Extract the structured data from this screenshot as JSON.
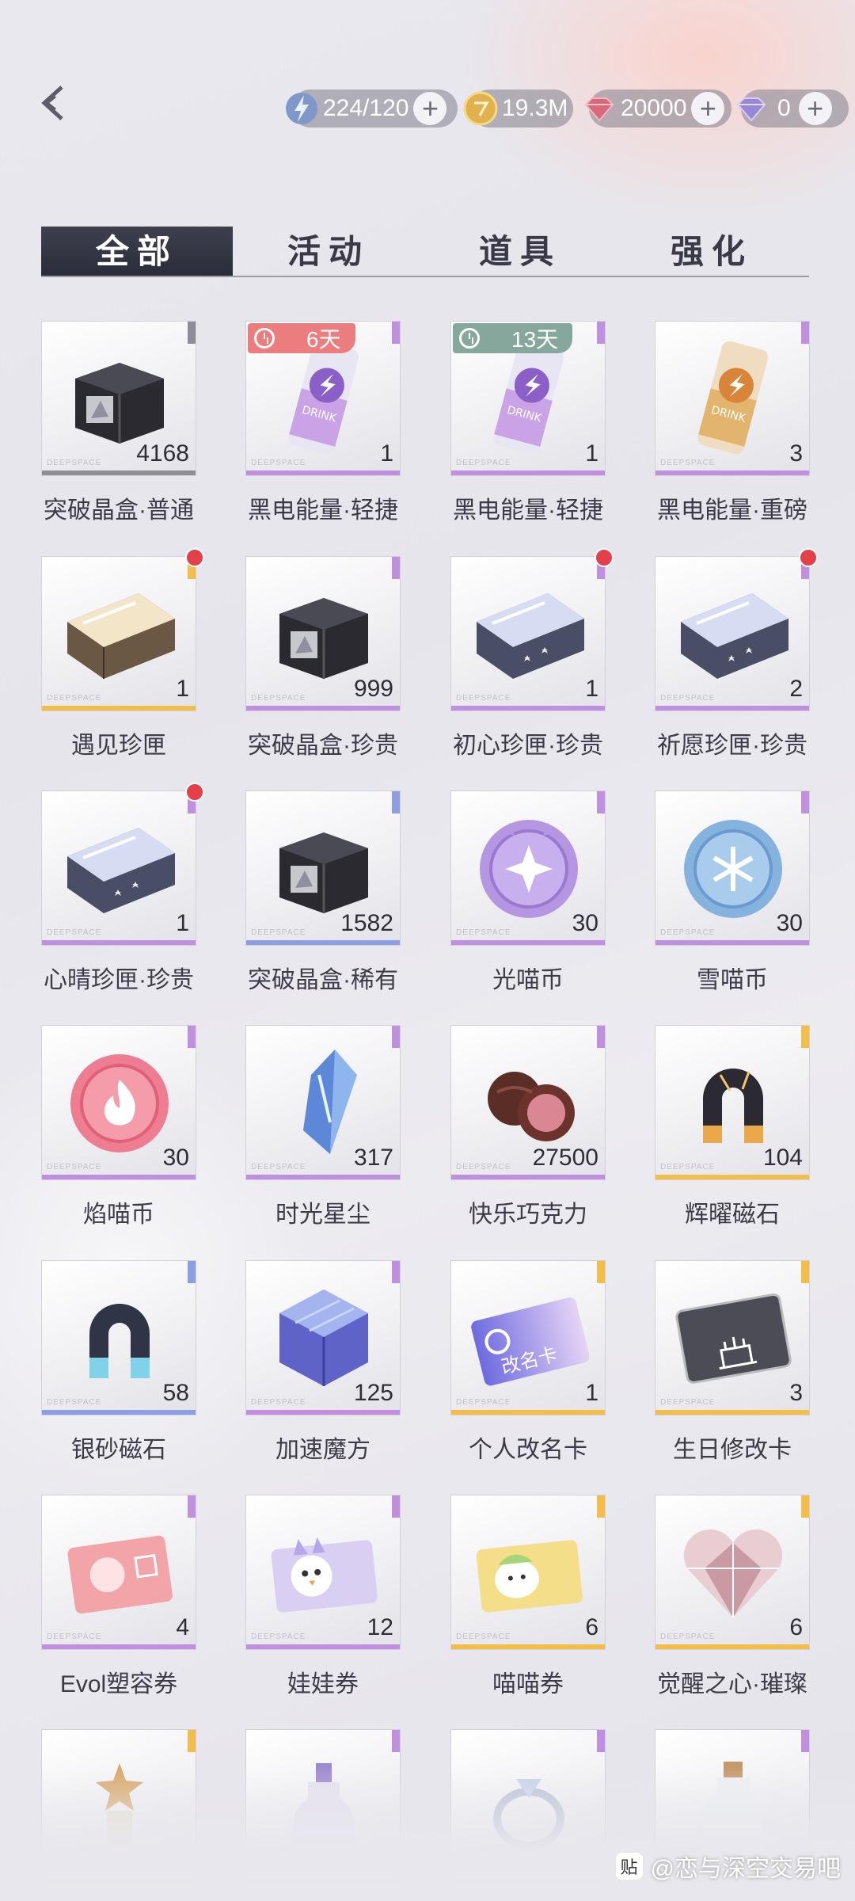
{
  "header": {
    "stamina": "224/120",
    "gold": "19.3M",
    "gems": "20000",
    "diamonds": "0"
  },
  "tabs": [
    {
      "label": "全部",
      "active": true
    },
    {
      "label": "活动",
      "active": false
    },
    {
      "label": "道具",
      "active": false
    },
    {
      "label": "强化",
      "active": false
    }
  ],
  "items": [
    {
      "name": "突破晶盒·普通",
      "qty": "4168",
      "icon": "black-box-icon",
      "rarity": "gray"
    },
    {
      "name": "黑电能量·轻捷",
      "qty": "1",
      "icon": "purple-drink-can-icon",
      "rarity": "purple",
      "timer": "6天",
      "timer_color": "#ec7d7e"
    },
    {
      "name": "黑电能量·轻捷",
      "qty": "1",
      "icon": "purple-drink-can-icon",
      "rarity": "purple",
      "timer": "13天",
      "timer_color": "#86a89c"
    },
    {
      "name": "黑电能量·重磅",
      "qty": "3",
      "icon": "gold-drink-can-icon",
      "rarity": "purple"
    },
    {
      "name": "遇见珍匣",
      "qty": "1",
      "icon": "gold-crystal-case-icon",
      "rarity": "gold",
      "dot": true
    },
    {
      "name": "突破晶盒·珍贵",
      "qty": "999",
      "icon": "black-box-icon",
      "rarity": "purple"
    },
    {
      "name": "初心珍匣·珍贵",
      "qty": "1",
      "icon": "crystal-case-icon",
      "rarity": "purple",
      "dot": true
    },
    {
      "name": "祈愿珍匣·珍贵",
      "qty": "2",
      "icon": "crystal-case-icon",
      "rarity": "purple",
      "dot": true
    },
    {
      "name": "心晴珍匣·珍贵",
      "qty": "1",
      "icon": "crystal-case-icon",
      "rarity": "purple",
      "dot": true
    },
    {
      "name": "突破晶盒·稀有",
      "qty": "1582",
      "icon": "black-box-icon",
      "rarity": "blue"
    },
    {
      "name": "光喵币",
      "qty": "30",
      "icon": "purple-coin-icon",
      "rarity": "purple"
    },
    {
      "name": "雪喵币",
      "qty": "30",
      "icon": "blue-coin-icon",
      "rarity": "purple"
    },
    {
      "name": "焰喵币",
      "qty": "30",
      "icon": "pink-coin-icon",
      "rarity": "purple"
    },
    {
      "name": "时光星尘",
      "qty": "317",
      "icon": "blue-crystal-icon",
      "rarity": "purple"
    },
    {
      "name": "快乐巧克力",
      "qty": "27500",
      "icon": "chocolate-icon",
      "rarity": "purple"
    },
    {
      "name": "辉曜磁石",
      "qty": "104",
      "icon": "gold-magnet-icon",
      "rarity": "gold"
    },
    {
      "name": "银砂磁石",
      "qty": "58",
      "icon": "silver-magnet-icon",
      "rarity": "blue"
    },
    {
      "name": "加速魔方",
      "qty": "125",
      "icon": "blue-cube-icon",
      "rarity": "purple"
    },
    {
      "name": "个人改名卡",
      "qty": "1",
      "icon": "rename-card-icon",
      "rarity": "gold",
      "card_text": "改名卡"
    },
    {
      "name": "生日修改卡",
      "qty": "3",
      "icon": "birthday-card-icon",
      "rarity": "gold"
    },
    {
      "name": "Evol塑容券",
      "qty": "4",
      "icon": "pink-ticket-icon",
      "rarity": "purple"
    },
    {
      "name": "娃娃券",
      "qty": "12",
      "icon": "doll-ticket-icon",
      "rarity": "purple"
    },
    {
      "name": "喵喵券",
      "qty": "6",
      "icon": "cat-ticket-icon",
      "rarity": "gold"
    },
    {
      "name": "觉醒之心·璀璨",
      "qty": "6",
      "icon": "crystal-heart-icon",
      "rarity": "gold"
    },
    {
      "name": "",
      "qty": "",
      "icon": "star-figure-icon",
      "rarity": "gold"
    },
    {
      "name": "",
      "qty": "",
      "icon": "potion-bottle-icon",
      "rarity": "purple"
    },
    {
      "name": "",
      "qty": "",
      "icon": "ring-icon",
      "rarity": "purple"
    },
    {
      "name": "",
      "qty": "",
      "icon": "glass-bottle-icon",
      "rarity": "purple"
    }
  ],
  "cell_brand": "DEEPSPACE",
  "watermark": "@恋与深空交易吧",
  "watermark_icon": "贴",
  "colors": {
    "gray": "#8f8e98",
    "purple": "#c08fe0",
    "blue": "#8d9fe2",
    "gold": "#f3bd4a"
  }
}
